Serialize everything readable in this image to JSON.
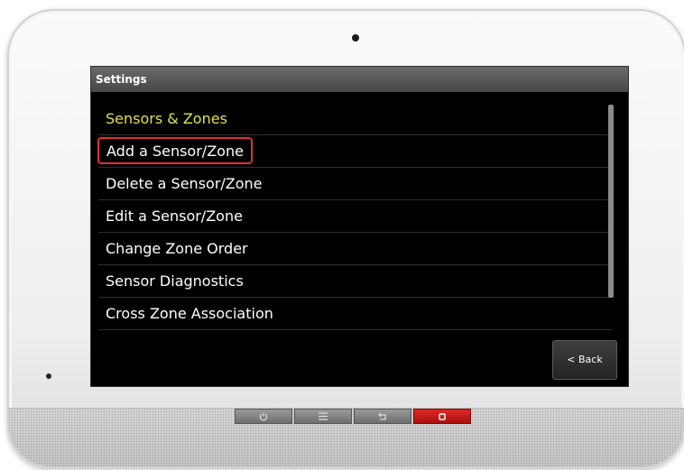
{
  "screen": {
    "title": "Settings"
  },
  "menu": {
    "header": "Sensors & Zones",
    "items": [
      {
        "label": "Add a Sensor/Zone",
        "highlighted": true
      },
      {
        "label": "Delete a Sensor/Zone",
        "highlighted": false
      },
      {
        "label": "Edit a Sensor/Zone",
        "highlighted": false
      },
      {
        "label": "Change Zone Order",
        "highlighted": false
      },
      {
        "label": "Sensor Diagnostics",
        "highlighted": false
      },
      {
        "label": "Cross Zone Association",
        "highlighted": false
      }
    ]
  },
  "back_button": {
    "label": "< Back"
  },
  "hardware_buttons": [
    {
      "icon": "power-icon"
    },
    {
      "icon": "menu-icon"
    },
    {
      "icon": "return-icon"
    },
    {
      "icon": "panic-icon"
    }
  ],
  "colors": {
    "header_text": "#e0e04a",
    "highlight_border": "#e03030",
    "panic_button": "#d01c1c"
  }
}
